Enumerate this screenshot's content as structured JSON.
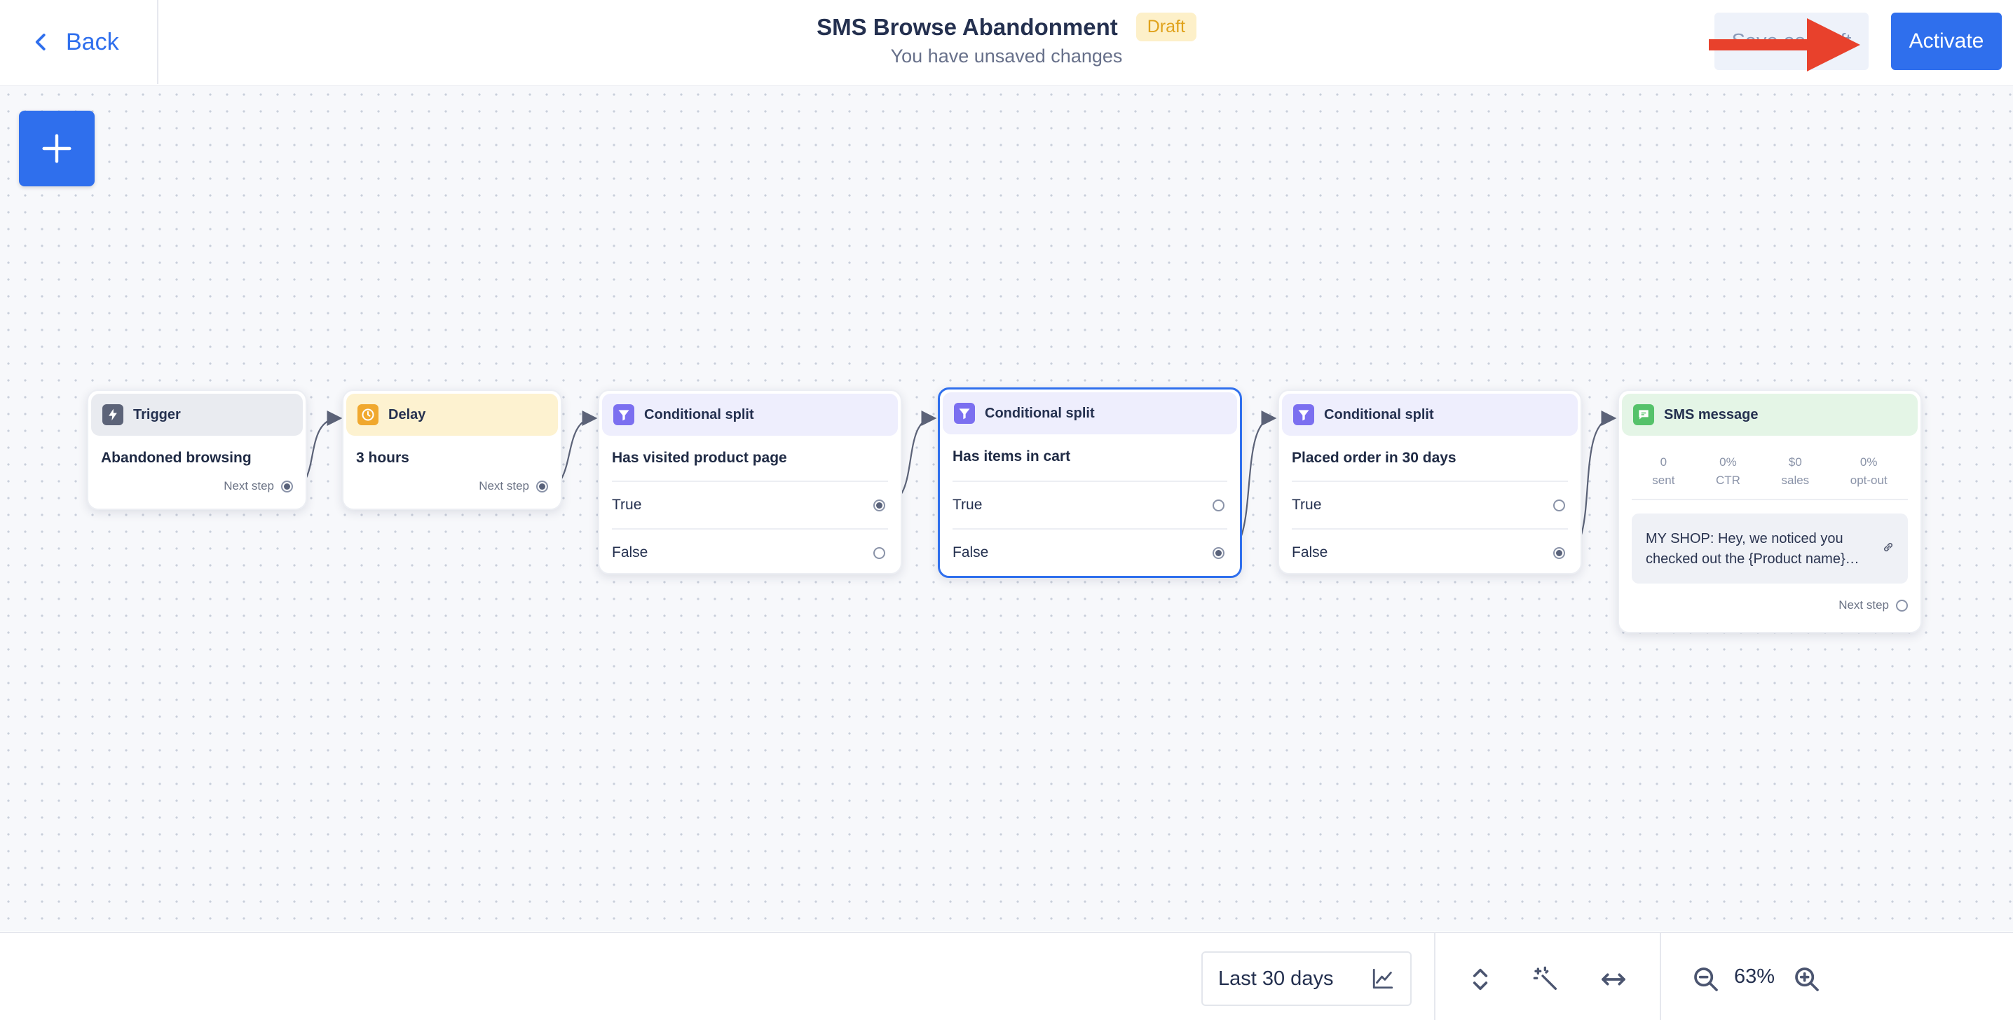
{
  "header": {
    "back_label": "Back",
    "title": "SMS Browse Abandonment",
    "badge": "Draft",
    "subtitle": "You have unsaved changes",
    "save_label": "Save as draft",
    "activate_label": "Activate"
  },
  "nodes": {
    "trigger": {
      "type": "Trigger",
      "title": "Abandoned browsing",
      "next_step": "Next step"
    },
    "delay": {
      "type": "Delay",
      "title": "3 hours",
      "next_step": "Next step"
    },
    "split1": {
      "type": "Conditional split",
      "title": "Has visited product page",
      "true_label": "True",
      "false_label": "False"
    },
    "split2": {
      "type": "Conditional split",
      "title": "Has items in cart",
      "true_label": "True",
      "false_label": "False"
    },
    "split3": {
      "type": "Conditional split",
      "title": "Placed order in 30 days",
      "true_label": "True",
      "false_label": "False"
    },
    "sms": {
      "type": "SMS message",
      "stats": [
        {
          "value": "0",
          "label": "sent"
        },
        {
          "value": "0%",
          "label": "CTR"
        },
        {
          "value": "$0",
          "label": "sales"
        },
        {
          "value": "0%",
          "label": "opt-out"
        }
      ],
      "message_line1": "MY SHOP: Hey, we noticed you",
      "message_line2": "checked out the {Product name}…",
      "next_step": "Next step"
    }
  },
  "toolbar": {
    "range_label": "Last 30 days",
    "zoom": "63%"
  },
  "colors": {
    "accent": "#2f6fed",
    "draft_badge_bg": "#fdf0c9",
    "draft_badge_text": "#e0a21b",
    "annotation_arrow": "#e8412c"
  },
  "icons": [
    "chevron-left-icon",
    "plus-icon",
    "lightning-icon",
    "clock-icon",
    "funnel-icon",
    "message-icon",
    "link-icon",
    "chart-icon",
    "expand-vertical-icon",
    "magic-wand-icon",
    "expand-horizontal-icon",
    "zoom-out-icon",
    "zoom-in-icon"
  ]
}
